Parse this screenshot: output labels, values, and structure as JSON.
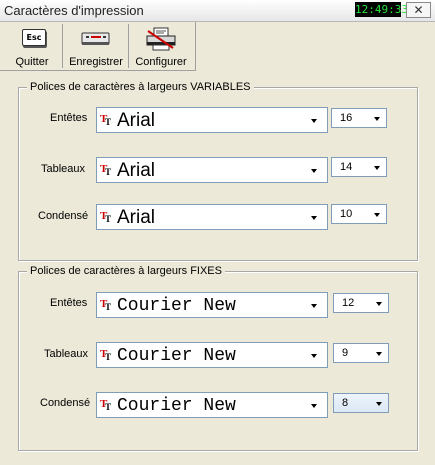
{
  "window": {
    "title": "Caractères d'impression",
    "clock": "12:49:33",
    "close_glyph": "✕"
  },
  "toolbar": {
    "quit": {
      "label": "Quitter",
      "icon_text": "Esc"
    },
    "save": {
      "label": "Enregistrer"
    },
    "configure": {
      "label": "Configurer"
    }
  },
  "variable_group": {
    "legend": "Polices de caractères à largeurs VARIABLES",
    "rows": [
      {
        "label": "Entêtes",
        "font": "Arial",
        "size": "16"
      },
      {
        "label": "Tableaux",
        "font": "Arial",
        "size": "14"
      },
      {
        "label": "Condensé",
        "font": "Arial",
        "size": "10"
      }
    ]
  },
  "fixed_group": {
    "legend": "Polices de caractères à largeurs FIXES",
    "rows": [
      {
        "label": "Entêtes",
        "font": "Courier New",
        "size": "12"
      },
      {
        "label": "Tableaux",
        "font": "Courier New",
        "size": "9"
      },
      {
        "label": "Condensé",
        "font": "Courier New",
        "size": "8"
      }
    ]
  },
  "colors": {
    "clock_text": "#27e03a",
    "truetype_red": "#cc0000",
    "window_bg": "#ece9d8"
  }
}
